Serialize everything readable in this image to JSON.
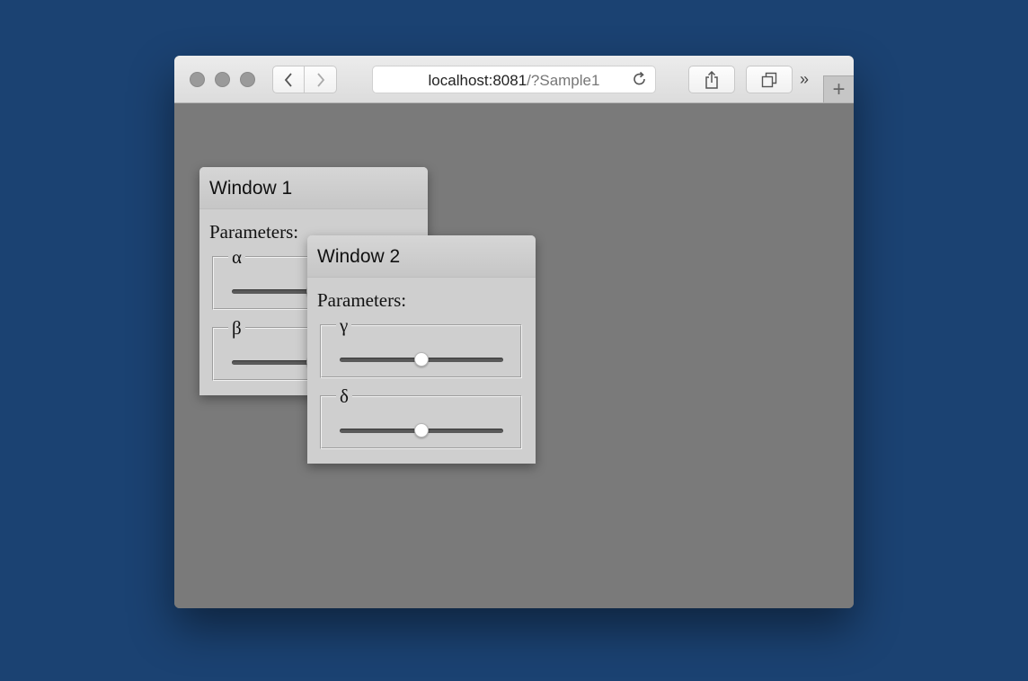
{
  "browser": {
    "address_host": "localhost:8081",
    "address_rest": "/?Sample1",
    "new_tab_label": "+",
    "overflow_label": "»"
  },
  "windows": [
    {
      "title": "Window 1",
      "parameters_label": "Parameters:",
      "params": [
        {
          "name": "α",
          "value": 0.5
        },
        {
          "name": "β",
          "value": 0.5
        }
      ]
    },
    {
      "title": "Window 2",
      "parameters_label": "Parameters:",
      "params": [
        {
          "name": "γ",
          "value": 0.5
        },
        {
          "name": "δ",
          "value": 0.5
        }
      ]
    }
  ],
  "colors": {
    "desktop": "#1b4272",
    "content_bg": "#7a7a7a",
    "window_bg": "#cfcfcf"
  },
  "icons": [
    "back-icon",
    "forward-icon",
    "reload-icon",
    "share-icon",
    "tabs-overview-icon",
    "new-tab-icon"
  ]
}
